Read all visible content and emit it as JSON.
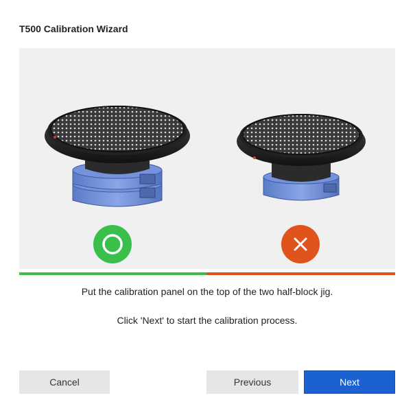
{
  "dialog": {
    "title": "T500 Calibration Wizard"
  },
  "illustrations": [
    {
      "name": "correct-setup",
      "status": "ok",
      "status_icon": "circle-check-icon",
      "color": "#3bbf4b"
    },
    {
      "name": "incorrect-setup",
      "status": "wrong",
      "status_icon": "cross-icon",
      "color": "#e0531d"
    }
  ],
  "instructions": {
    "line1": "Put the calibration panel on the top of the two half-block jig.",
    "line2": "Click 'Next' to start the calibration process."
  },
  "buttons": {
    "cancel": "Cancel",
    "previous": "Previous",
    "next": "Next"
  },
  "colors": {
    "accent_blue": "#1b62d0",
    "ok_green": "#3bbf4b",
    "error_orange": "#e0531d",
    "jig_blue": "#6f8fd6"
  }
}
